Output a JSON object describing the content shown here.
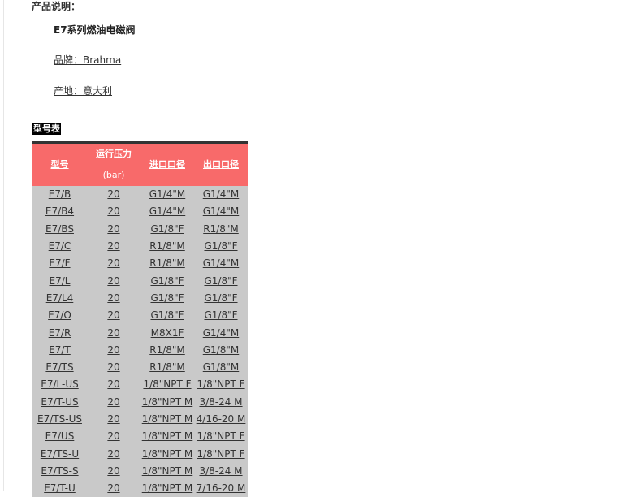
{
  "section_label": "产品说明：",
  "product_title": "E7系列燃油电磁阀",
  "brand": "品牌：Brahma",
  "origin": "产地：意大利",
  "table_title": "型号表",
  "table": {
    "headers": [
      "型号",
      "运行压力",
      "(bar)",
      "进口口径",
      "出口口径"
    ],
    "rows": [
      [
        "E7/B",
        "20",
        "G1/4\"M",
        "G1/4\"M"
      ],
      [
        "E7/B4",
        "20",
        "G1/4\"M",
        "G1/4\"M"
      ],
      [
        "E7/BS",
        "20",
        "G1/8\"F",
        "R1/8\"M"
      ],
      [
        "E7/C",
        "20",
        "R1/8\"M",
        "G1/8\"F"
      ],
      [
        "E7/F",
        "20",
        "R1/8\"M",
        "G1/4\"M"
      ],
      [
        "E7/L",
        "20",
        "G1/8\"F",
        "G1/8\"F"
      ],
      [
        "E7/L4",
        "20",
        "G1/8\"F",
        "G1/8\"F"
      ],
      [
        "E7/O",
        "20",
        "G1/8\"F",
        "G1/8\"F"
      ],
      [
        "E7/R",
        "20",
        "M8X1F",
        "G1/4\"M"
      ],
      [
        "E7/T",
        "20",
        "R1/8\"M",
        "G1/8\"M"
      ],
      [
        "E7/TS",
        "20",
        "R1/8\"M",
        "G1/8\"M"
      ],
      [
        "E7/L-US",
        "20",
        "1/8\"NPT F",
        "1/8\"NPT F"
      ],
      [
        "E7/T-US",
        "20",
        "1/8\"NPT M",
        "3/8-24 M"
      ],
      [
        "E7/TS-US",
        "20",
        "1/8\"NPT M",
        "4/16-20 M"
      ],
      [
        "E7/US",
        "20",
        "1/8\"NPT M",
        "1/8\"NPT F"
      ],
      [
        "E7/TS-U",
        "20",
        "1/8\"NPT M",
        "1/8\"NPT F"
      ],
      [
        "E7/TS-S",
        "20",
        "1/8\"NPT M",
        "3/8-24 M"
      ],
      [
        "E7/T-U",
        "20",
        "1/8\"NPT M",
        "7/16-20 M"
      ]
    ]
  },
  "colors": {
    "header_bg": "#f86a6a",
    "row_bg": "#c9c9c9",
    "title_bg": "#000000"
  }
}
